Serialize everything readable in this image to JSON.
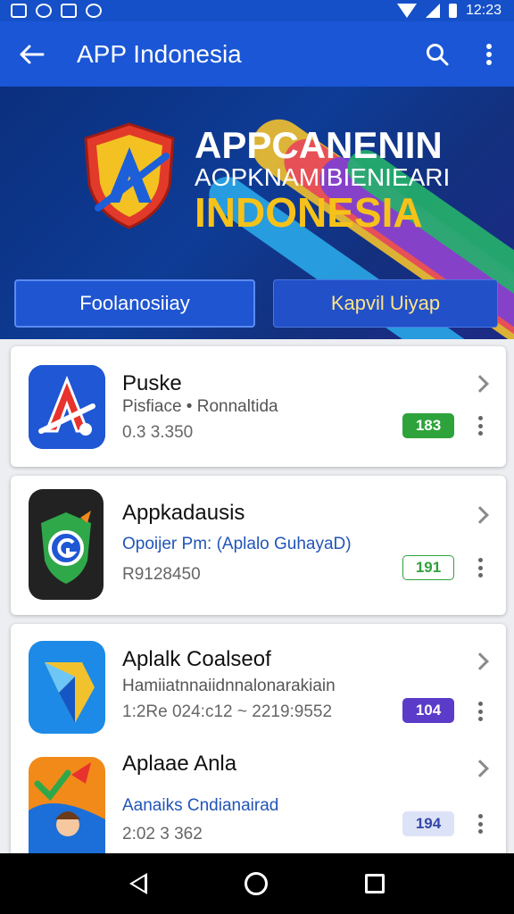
{
  "status_bar": {
    "time": "12:23"
  },
  "app_bar": {
    "title": "APP Indonesia",
    "back_icon": "arrow-left-icon",
    "search_icon": "search-icon",
    "more_icon": "more-vert-icon"
  },
  "hero": {
    "title_line1": "APPCANENIN",
    "title_line2": "AOPKNAMIBIENIEARI",
    "title_line3": "INDONESIA",
    "button_left": "Foolanosiiay",
    "button_right": "Kapvil Uiyap"
  },
  "apps": [
    {
      "name": "Puske",
      "desc": "Pisfiace • Ronnaltida",
      "meta": "0.3 3.350",
      "badge": "183",
      "badge_bg": "#2fa33b",
      "badge_color": "#ffffff"
    },
    {
      "name": "Appkadausis",
      "desc": "Opoijer Pm: (Aplalo GuhayaD)",
      "meta": "R9128450",
      "badge": "191",
      "badge_bg": "#ffffff",
      "badge_color": "#2fa33b"
    },
    {
      "name": "Aplalk Coalseof",
      "desc": "Hamiiatnnaiidnnalonarakiain",
      "meta": "1:2Re 024:c12 ~ 2219:9552",
      "badge": "104",
      "badge_bg": "#5b3cc8",
      "badge_color": "#ffffff"
    },
    {
      "name": "Aplaae Anla",
      "desc": "Aanaiks Cndianairad",
      "meta": "2:02 3 362",
      "badge": "194",
      "badge_bg": "#dde3f7",
      "badge_color": "#3447a8"
    }
  ]
}
